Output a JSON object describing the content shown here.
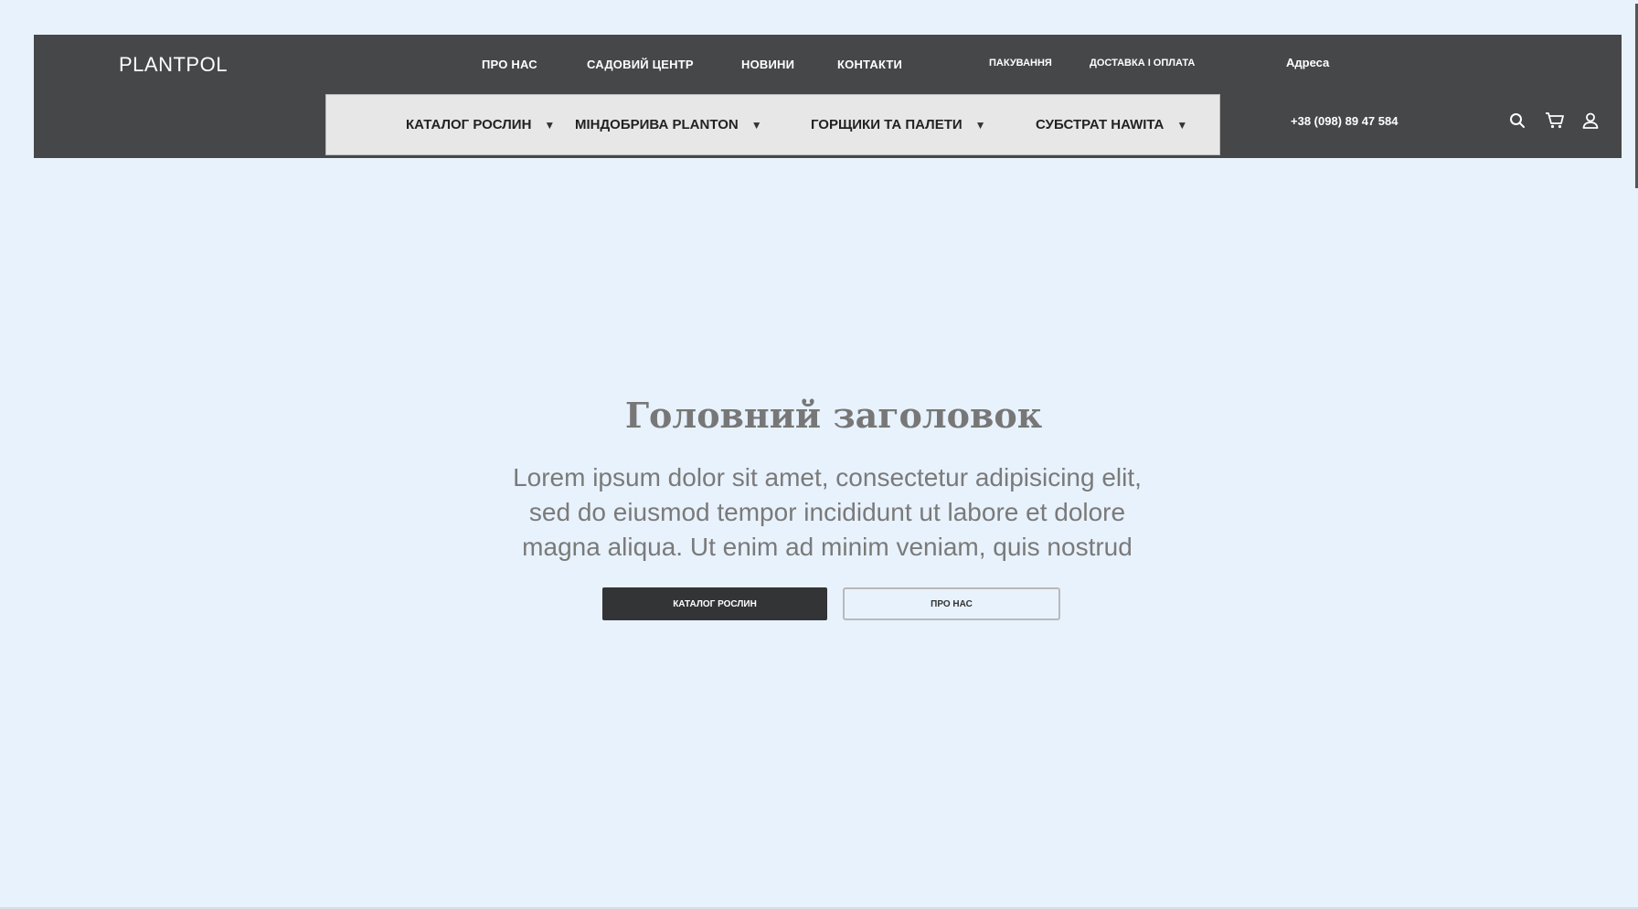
{
  "brand": {
    "logo": "PLANTPOL"
  },
  "top_nav": [
    {
      "label": "ПРО НАС"
    },
    {
      "label": "САДОВИЙ ЦЕНТР"
    },
    {
      "label": "НОВИНИ"
    },
    {
      "label": "КОНТАКТИ"
    }
  ],
  "secondary_nav": [
    {
      "label": "ПАКУВАННЯ"
    },
    {
      "label": "ДОСТАВКА І ОПЛАТА"
    }
  ],
  "contact": {
    "address_label": "Адреса",
    "phone": "+38 (098) 89 47 584"
  },
  "category_nav": [
    {
      "label": "КАТАЛОГ РОСЛИН",
      "arrow": "▼"
    },
    {
      "label": "МІНДОБРИВА PLANTON",
      "arrow": "▼"
    },
    {
      "label": "ГОРЩИКИ ТА ПАЛЕТИ",
      "arrow": "▼"
    },
    {
      "label": "СУБСТРАТ HAWITA",
      "arrow": "▼"
    }
  ],
  "header_icons": [
    "search-icon",
    "cart-icon",
    "user-icon"
  ],
  "hero": {
    "title": "Головний заголовок",
    "text": "Lorem ipsum dolor sit amet, consectetur adipisicing elit, sed do eiusmod tempor incididunt ut labore et dolore magna aliqua. Ut enim ad minim veniam, quis nostrud",
    "primary_button": "КАТАЛОГ РОСЛИН",
    "secondary_button": "ПРО НАС"
  },
  "colors": {
    "page_background": "#e8f2fc",
    "header_background": "#464749",
    "category_bar_background": "#e7e7e7",
    "primary_button": "#333436",
    "hero_text": "#7a7a7a"
  }
}
